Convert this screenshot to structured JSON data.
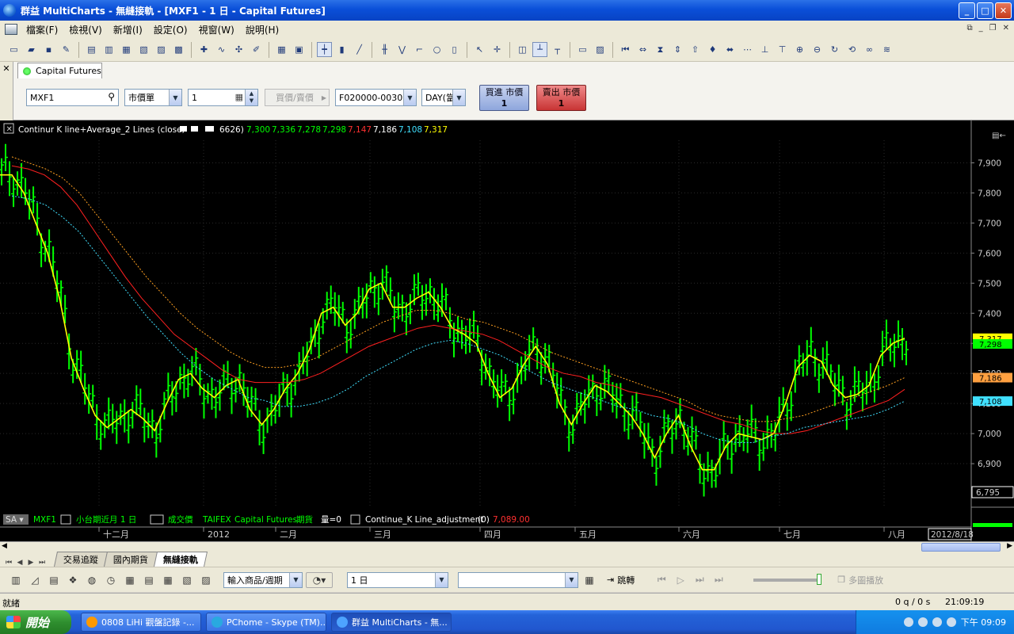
{
  "window": {
    "title": "群益 MultiCharts - 無縫接軌 - [MXF1 - 1 日 - Capital Futures]",
    "min": "_",
    "max": "□",
    "close": "✕"
  },
  "menu": [
    "檔案(F)",
    "檢視(V)",
    "新增(I)",
    "設定(O)",
    "視窗(W)",
    "說明(H)"
  ],
  "order_panel": {
    "close": "✕",
    "tab": "Capital Futures",
    "symbol": "MXF1",
    "order_type": "市價單",
    "quantity": "1",
    "price_button": "買價/賣價",
    "account": "F020000-003013",
    "tif": "DAY(當",
    "buy_label": "買進 市價",
    "buy_qty": "1",
    "sell_label": "賣出 市價",
    "sell_qty": "1"
  },
  "chart": {
    "indicator_header": {
      "name": "Continur K line+Average_2 Lines  (close,",
      "param": "6626)",
      "values": [
        "7,300",
        "7,336",
        "7,278",
        "7,298",
        "7,147",
        "7,186",
        "7,108",
        "7,317"
      ],
      "colors": [
        "#00ff00",
        "#00ff00",
        "#00ff00",
        "#00ff00",
        "#ff3030",
        "#ffffff",
        "#40e0ff",
        "#ffff00"
      ]
    },
    "y_ticks": [
      "7,900",
      "7,800",
      "7,700",
      "7,600",
      "7,500",
      "7,400",
      "7,300",
      "7,200",
      "7,100",
      "7,000",
      "6,900"
    ],
    "price_tags": [
      {
        "label": "7,317",
        "bg": "#ffff00"
      },
      {
        "label": "7,298",
        "bg": "#00ff00"
      },
      {
        "label": "7,186",
        "bg": "#ffa040"
      },
      {
        "label": "7,108",
        "bg": "#40e0ff"
      }
    ],
    "lower_value": "6,795",
    "x_labels": [
      "十二月",
      "2012",
      "二月",
      "三月",
      "四月",
      "五月",
      "六月",
      "七月",
      "八月"
    ],
    "date_box": "2012/8/18",
    "legend": {
      "sa": "SA",
      "symbol": "MXF1",
      "desc": "小台期近月  1 日",
      "field": "成交價",
      "exchange": "TAIFEX",
      "broker": "Capital Futures",
      "type": "期貨",
      "volume": "量=0",
      "study": "Continue_K Line_adjustment",
      "study_param": "(0)",
      "study_value": "7,089.00"
    },
    "colors": {
      "bars": "#00ff00",
      "fast": "#ffff00",
      "mid": "#ff2020",
      "upper": "#ffa020",
      "lower": "#40e0ff"
    }
  },
  "chart_data": {
    "type": "line",
    "title": "",
    "ylim": [
      6750,
      7975
    ],
    "y_ticks": [
      6900,
      7000,
      7100,
      7200,
      7300,
      7400,
      7500,
      7600,
      7700,
      7800,
      7900
    ],
    "x_labels": [
      "十二月",
      "2012",
      "二月",
      "三月",
      "四月",
      "五月",
      "六月",
      "七月",
      "八月"
    ],
    "series": [
      {
        "color": "#ffff00",
        "values": [
          7860,
          7860,
          7800,
          7700,
          7600,
          7450,
          7250,
          7150,
          7060,
          7020,
          7050,
          7080,
          7050,
          7010,
          7100,
          7180,
          7200,
          7150,
          7120,
          7160,
          7180,
          7080,
          7030,
          7080,
          7150,
          7200,
          7280,
          7400,
          7420,
          7360,
          7400,
          7480,
          7500,
          7420,
          7420,
          7450,
          7470,
          7420,
          7350,
          7330,
          7300,
          7200,
          7120,
          7150,
          7230,
          7290,
          7230,
          7100,
          7030,
          7100,
          7160,
          7140,
          7100,
          7060,
          7000,
          6920,
          7000,
          7060,
          6960,
          6880,
          6880,
          6960,
          7000,
          6990,
          6980,
          7000,
          7100,
          7220,
          7260,
          7240,
          7160,
          7120,
          7130,
          7160,
          7260,
          7300,
          7317
        ]
      },
      {
        "color": "#ff2020",
        "values": [
          7890,
          7880,
          7860,
          7820,
          7760,
          7680,
          7600,
          7520,
          7450,
          7390,
          7330,
          7290,
          7250,
          7210,
          7180,
          7170,
          7170,
          7170,
          7180,
          7200,
          7230,
          7260,
          7290,
          7310,
          7330,
          7350,
          7360,
          7350,
          7340,
          7330,
          7310,
          7280,
          7250,
          7220,
          7200,
          7190,
          7170,
          7160,
          7140,
          7130,
          7120,
          7100,
          7080,
          7060,
          7040,
          7030,
          7010,
          7000,
          7000,
          7010,
          7030,
          7050,
          7070,
          7090,
          7110,
          7147
        ]
      },
      {
        "color": "#ffa020",
        "values": [
          7920,
          7900,
          7880,
          7850,
          7800,
          7730,
          7660,
          7590,
          7520,
          7460,
          7400,
          7350,
          7310,
          7270,
          7240,
          7220,
          7220,
          7230,
          7250,
          7280,
          7310,
          7340,
          7370,
          7390,
          7410,
          7410,
          7400,
          7380,
          7370,
          7350,
          7330,
          7300,
          7270,
          7250,
          7230,
          7210,
          7190,
          7170,
          7150,
          7130,
          7110,
          7080,
          7060,
          7050,
          7040,
          7040,
          7050,
          7060,
          7080,
          7100,
          7120,
          7140,
          7160,
          7186
        ]
      },
      {
        "color": "#40e0ff",
        "values": [
          7790,
          7780,
          7760,
          7720,
          7670,
          7600,
          7530,
          7460,
          7390,
          7330,
          7270,
          7220,
          7180,
          7150,
          7120,
          7110,
          7090,
          7090,
          7100,
          7120,
          7150,
          7190,
          7220,
          7250,
          7280,
          7300,
          7310,
          7300,
          7280,
          7260,
          7230,
          7200,
          7170,
          7150,
          7130,
          7110,
          7090,
          7080,
          7060,
          7050,
          7030,
          7000,
          6980,
          6970,
          6970,
          6990,
          7000,
          7020,
          7030,
          7040,
          7050,
          7060,
          7080,
          7108
        ]
      }
    ]
  },
  "sheet_tabs": [
    "交易追蹤",
    "國內期貨",
    "無縫接軌"
  ],
  "toolbar2": {
    "symbol_input": "輸入商品/週期",
    "interval": "1 日",
    "jump": "跳轉",
    "multi_play": "多圖播放"
  },
  "status": {
    "left": "就緒",
    "perf": "0 q / 0 s",
    "time": "21:09:19"
  },
  "taskbar": {
    "start": "開始",
    "items": [
      "0808 LiHi 觀盤記錄 -...",
      "PChome - Skype (TM)...",
      "群益 MultiCharts - 無..."
    ],
    "clock": "下午 09:09"
  }
}
